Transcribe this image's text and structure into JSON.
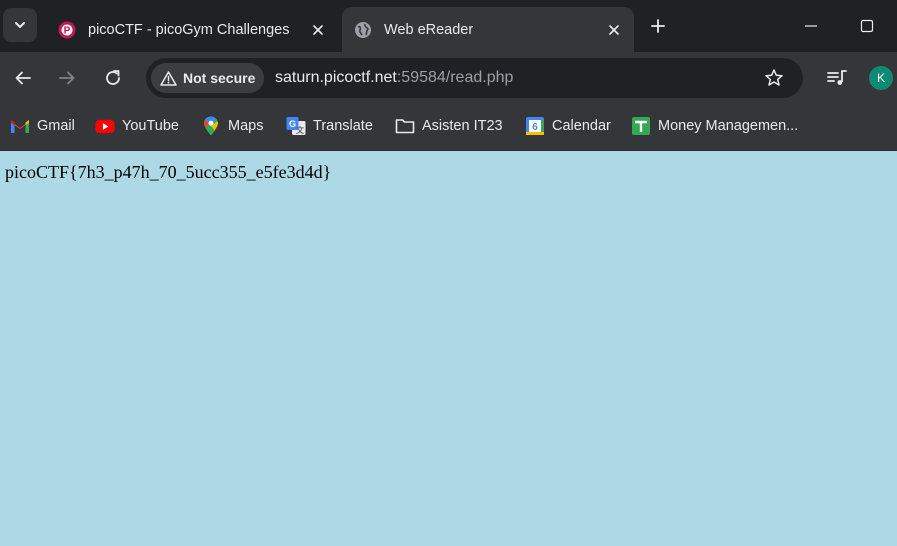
{
  "tabs": [
    {
      "title": "picoCTF - picoGym Challenges",
      "favicon": "picoctf-icon",
      "active": false
    },
    {
      "title": "Web eReader",
      "favicon": "globe-icon",
      "active": true
    }
  ],
  "address_bar": {
    "security_label": "Not secure",
    "url_host": "saturn.picoctf.net",
    "url_rest": ":59584/read.php"
  },
  "profile": {
    "initial": "K",
    "color": "#0f8a73"
  },
  "bookmarks": [
    {
      "label": "Gmail",
      "icon": "gmail-icon"
    },
    {
      "label": "YouTube",
      "icon": "youtube-icon"
    },
    {
      "label": "Maps",
      "icon": "maps-icon"
    },
    {
      "label": "Translate",
      "icon": "translate-icon"
    },
    {
      "label": "Asisten IT23",
      "icon": "folder-icon"
    },
    {
      "label": "Calendar",
      "icon": "calendar-icon"
    },
    {
      "label": "Money Managemen...",
      "icon": "sheets-icon"
    }
  ],
  "page": {
    "background": "#add8e6",
    "content": "picoCTF{7h3_p47h_70_5ucc355_e5fe3d4d}"
  }
}
